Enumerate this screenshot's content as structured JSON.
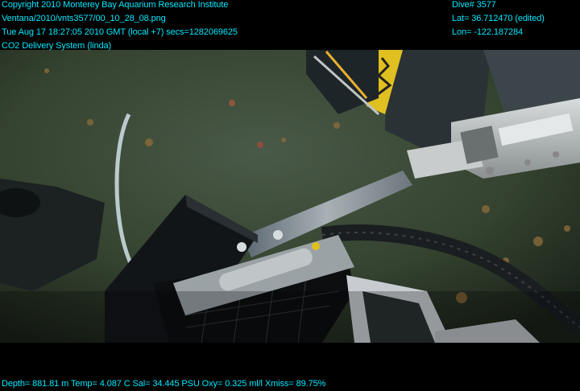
{
  "header_left": {
    "line1": "Copyright 2010 Monterey Bay Aquarium Research Institute",
    "line2": "Ventana/2010/vnts3577/00_10_28_08.png",
    "line3": "Tue Aug 17 18:27:05 2010 GMT (local +7)  secs=1282069625",
    "line4": "CO2 Delivery System (linda)"
  },
  "header_right": {
    "line1": "Dive# 3577",
    "line2": "Lat= 36.712470 (edited)",
    "line3": "Lon= -122.187284"
  },
  "footer": {
    "telemetry": "Depth= 881.81 m  Temp= 4.087 C  Sal= 34.445 PSU  Oxy= 0.325 ml/l  Xmiss= 89.75%"
  },
  "colors": {
    "overlay_text": "#00e8ff",
    "seafloor": "#3a4638",
    "background": "#000000"
  },
  "icons": [
    "robotic-arm",
    "sample-crate",
    "hose"
  ]
}
